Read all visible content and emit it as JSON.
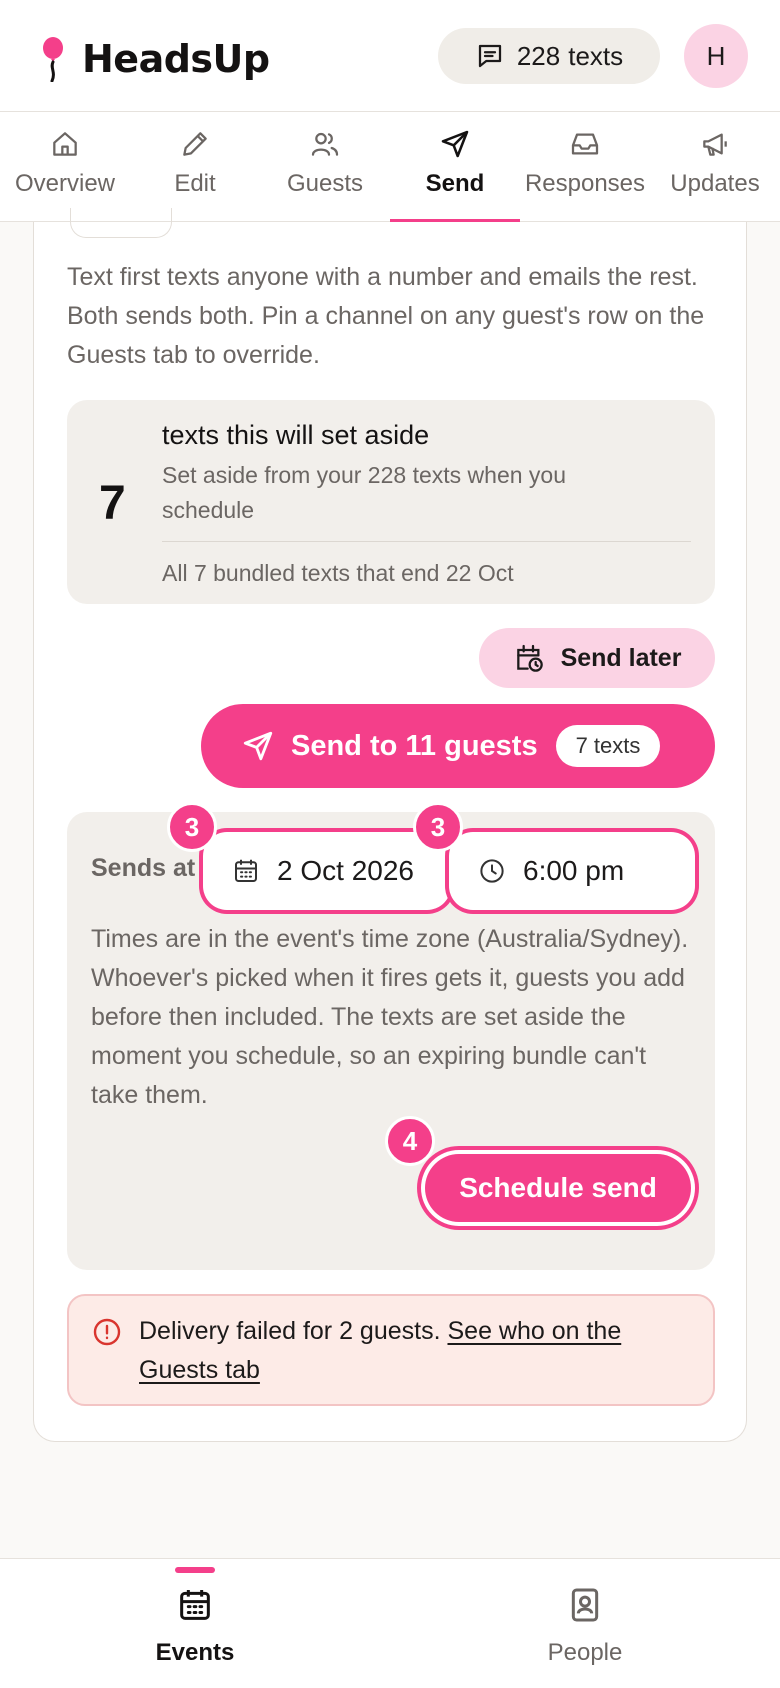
{
  "app": {
    "name": "HeadsUp"
  },
  "header": {
    "credits_count": "228",
    "credits_label": "texts",
    "avatar_initial": "H"
  },
  "tabs": [
    {
      "label": "Overview",
      "icon": "home-icon"
    },
    {
      "label": "Edit",
      "icon": "pencil-icon"
    },
    {
      "label": "Guests",
      "icon": "users-icon"
    },
    {
      "label": "Send",
      "icon": "send-icon",
      "active": true
    },
    {
      "label": "Responses",
      "icon": "inbox-icon"
    },
    {
      "label": "Updates",
      "icon": "megaphone-icon"
    }
  ],
  "send": {
    "intro": "Text first texts anyone with a number and emails the rest. Both sends both. Pin a channel on any guest's row on the Guests tab to override.",
    "reserve": {
      "count": "7",
      "title": "texts this will set aside",
      "subtitle": "Set aside from your 228 texts when you schedule",
      "note": "All 7 bundled texts that end 22 Oct"
    },
    "send_later_label": "Send later",
    "send_now_label": "Send to 11 guests",
    "send_now_pill": "7 texts",
    "schedule": {
      "sends_at_label": "Sends at",
      "date_value": "2 Oct 2026",
      "time_value": "6:00 pm",
      "date_badge": "3",
      "time_badge": "3",
      "note": "Times are in the event's time zone (Australia/Sydney). Whoever's picked when it fires gets it, guests you add before then included. The texts are set aside the moment you schedule, so an expiring bundle can't take them.",
      "button_label": "Schedule send",
      "button_badge": "4"
    },
    "alert": {
      "text": "Delivery failed for 2 guests.",
      "link": "See who on the Guests tab"
    }
  },
  "bottom_nav": [
    {
      "label": "Events",
      "icon": "calendar-icon",
      "active": true
    },
    {
      "label": "People",
      "icon": "contact-icon"
    }
  ],
  "colors": {
    "accent": "#f43f8a",
    "accent_soft": "#fbd3e4",
    "panel": "#f2efeb",
    "alert_bg": "#fdebe7",
    "alert_icon": "#d9352f"
  }
}
